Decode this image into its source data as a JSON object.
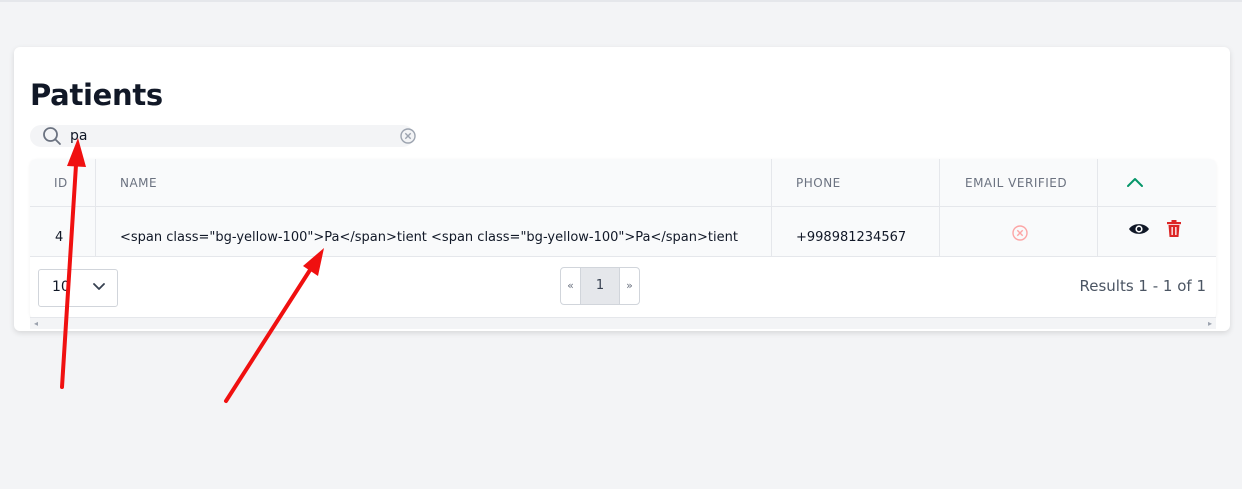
{
  "page": {
    "title": "Patients"
  },
  "search": {
    "value": "pa"
  },
  "table": {
    "headers": {
      "id": "ID",
      "name": "NAME",
      "phone": "PHONE",
      "email_verified": "EMAIL VERIFIED"
    },
    "rows": [
      {
        "id": "4",
        "name": "<span class=\"bg-yellow-100\">Pa</span>tient <span class=\"bg-yellow-100\">Pa</span>tient",
        "phone": "+998981234567"
      }
    ]
  },
  "pagination": {
    "per_page": "10",
    "prev": "«",
    "current_page": "1",
    "next": "»",
    "results_text": "Results 1 - 1 of 1"
  },
  "scrollbar": {
    "left": "◂",
    "right": "▸"
  },
  "colors": {
    "accent_green": "#059669",
    "delete_red": "#dc2626",
    "annotation_arrow": "#f01010",
    "unverified_icon": "#fca5a5"
  }
}
